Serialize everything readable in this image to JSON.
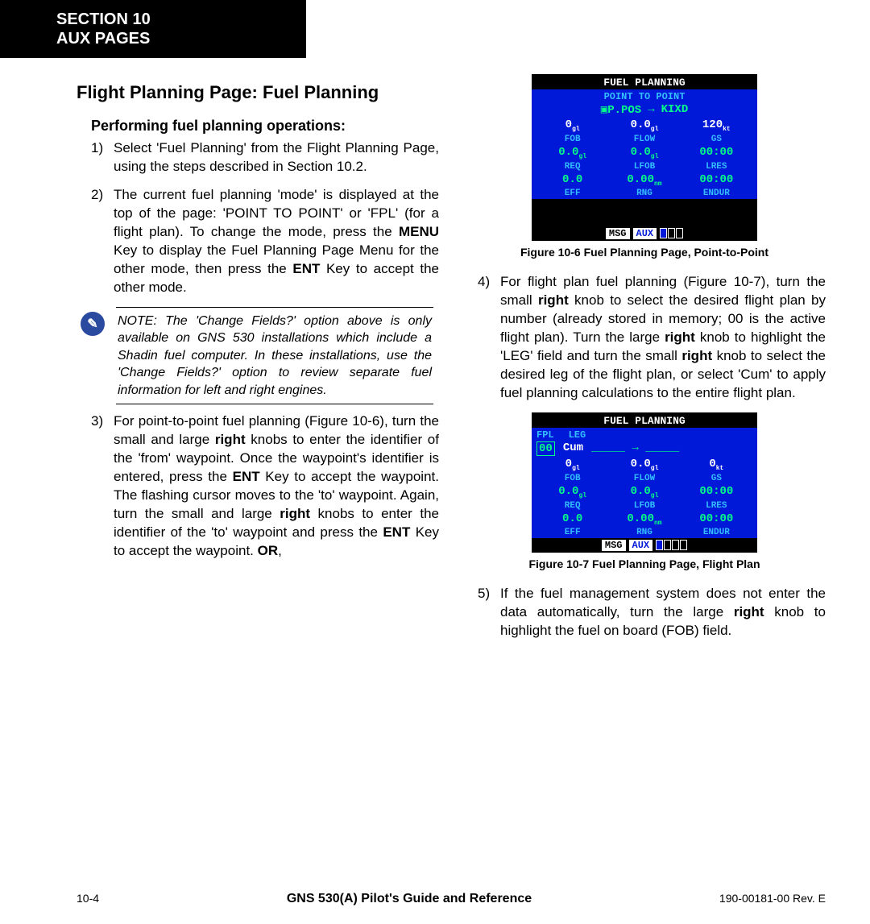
{
  "header": {
    "line1": "SECTION 10",
    "line2": "AUX PAGES"
  },
  "title": "Flight Planning Page: Fuel Planning",
  "subhead": "Performing fuel planning operations:",
  "steps_left": [
    {
      "num": "1)",
      "html": "Select 'Fuel Planning' from the Flight Planning Page, using the steps described in Section 10.2."
    },
    {
      "num": "2)",
      "html": "The current fuel planning 'mode' is displayed at the top of the page: 'POINT TO POINT' or 'FPL' (for a flight plan).  To change the mode, press the <b>MENU</b> Key to display the Fuel Planning Page Menu for the other mode, then press the <b>ENT</b> Key to accept the other mode."
    }
  ],
  "note_text": "NOTE: The 'Change Fields?' option above is only available on GNS 530 installations which include a Shadin fuel computer.  In these installations, use the 'Change Fields?' option to review separate fuel information for left and right engines.",
  "step3": {
    "num": "3)",
    "html": "For point-to-point fuel planning (Figure 10-6), turn the small and large <b>right</b> knobs to enter the identifier of the 'from' waypoint.  Once the waypoint's identifier is entered, press the <b>ENT</b> Key to accept the waypoint.  The flashing cursor moves to the 'to' waypoint.  Again, turn the small and large <b>right</b> knobs to enter the identifier of the 'to' waypoint and press the <b>ENT</b> Key to accept the waypoint. <b>OR</b>,"
  },
  "steps_right": [
    {
      "num": "4)",
      "html": "For flight plan fuel planning (Figure 10-7), turn the small <b>right</b> knob to select the desired flight plan by number (already stored in memory; 00 is the active flight plan).  Turn the large <b>right</b> knob to highlight the 'LEG' field and turn the small <b>right</b> knob to select the desired leg of the flight plan, or select 'Cum' to apply fuel planning calculations to the entire flight plan."
    },
    {
      "num": "5)",
      "html": "If the fuel management system does not enter the data automatically, turn the large <b>right</b> knob to highlight the fuel on board (FOB) field."
    }
  ],
  "fig1": {
    "caption": "Figure 10-6  Fuel Planning Page, Point-to-Point",
    "title": "FUEL PLANNING",
    "mode": "POINT TO POINT",
    "from": "P.POS",
    "arrow": "→",
    "to": "KIXD",
    "row1": {
      "fob": "0",
      "fob_u": "gl",
      "flow": "0.0",
      "flow_u": "gl",
      "gs": "120",
      "gs_u": "kt"
    },
    "labels1": {
      "a": "FOB",
      "b": "FLOW",
      "c": "GS"
    },
    "row2": {
      "req": "0.0",
      "req_u": "gl",
      "lfob": "0.0",
      "lfob_u": "gl",
      "lres": "00:00"
    },
    "labels2": {
      "a": "REQ",
      "b": "LFOB",
      "c": "LRES"
    },
    "row3": {
      "eff": "0.0",
      "rng": "0.00",
      "rng_u": "nm",
      "endur": "00:00"
    },
    "labels3": {
      "a": "EFF",
      "b": "RNG",
      "c": "ENDUR"
    },
    "msg": "MSG",
    "aux": "AUX"
  },
  "fig2": {
    "caption": "Figure 10-7  Fuel Planning Page, Flight Plan",
    "title": "FUEL PLANNING",
    "mode_a": "FPL",
    "mode_b": "LEG",
    "fpl_num": "00",
    "leg": "Cum",
    "row1": {
      "fob": "0",
      "fob_u": "gl",
      "flow": "0.0",
      "flow_u": "gl",
      "gs": "0",
      "gs_u": "kt"
    },
    "labels1": {
      "a": "FOB",
      "b": "FLOW",
      "c": "GS"
    },
    "row2": {
      "req": "0.0",
      "req_u": "gl",
      "lfob": "0.0",
      "lfob_u": "gl",
      "lres": "00:00"
    },
    "labels2": {
      "a": "REQ",
      "b": "LFOB",
      "c": "LRES"
    },
    "row3": {
      "eff": "0.0",
      "rng": "0.00",
      "rng_u": "nm",
      "endur": "00:00"
    },
    "labels3": {
      "a": "EFF",
      "b": "RNG",
      "c": "ENDUR"
    },
    "msg": "MSG",
    "aux": "AUX"
  },
  "footer": {
    "left": "10-4",
    "center": "GNS 530(A) Pilot's Guide and Reference",
    "right": "190-00181-00  Rev. E"
  }
}
